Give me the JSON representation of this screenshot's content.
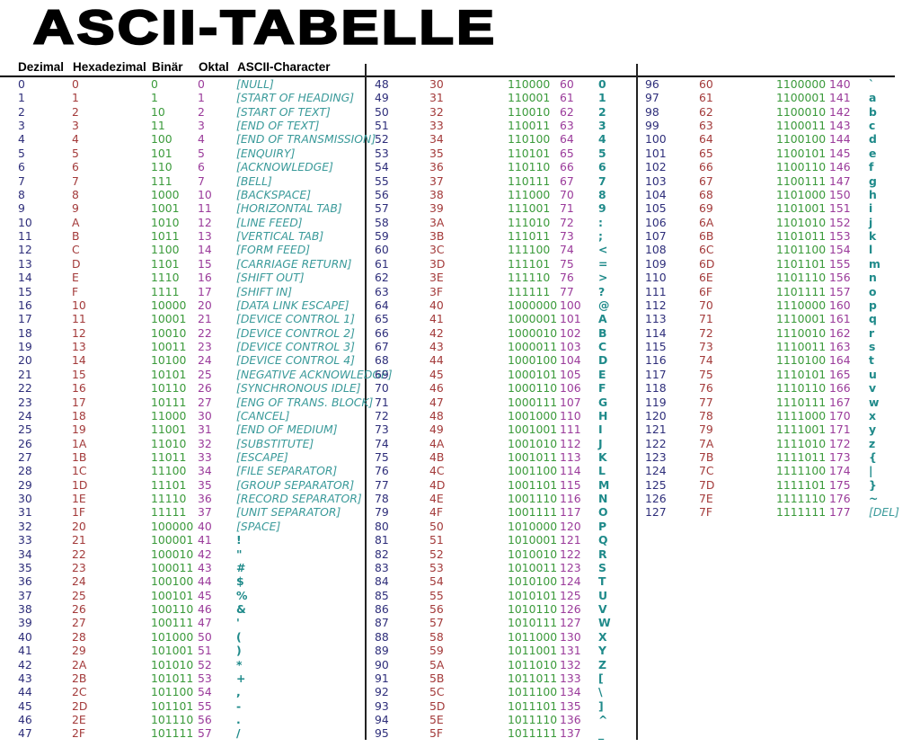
{
  "title": "ASCII-TABELLE",
  "headers": {
    "decimal": "Dezimal",
    "hex": "Hexadezimal",
    "binary": "Binär",
    "octal": "Oktal",
    "char": "ASCII-Character"
  },
  "colors": {
    "decimal": "#2e2e7a",
    "hex": "#a33a3a",
    "binary": "#3a9a3a",
    "octal": "#9a3a9a",
    "char": "#1f8a8a"
  },
  "control_names": [
    "[NULL]",
    "[START OF HEADING]",
    "[START OF TEXT]",
    "[END OF TEXT]",
    "[END OF TRANSMISSION]",
    "[ENQUIRY]",
    "[ACKNOWLEDGE]",
    "[BELL]",
    "[BACKSPACE]",
    "[HORIZONTAL TAB]",
    "[LINE FEED]",
    "[VERTICAL TAB]",
    "[FORM FEED]",
    "[CARRIAGE RETURN]",
    "[SHIFT OUT]",
    "[SHIFT IN]",
    "[DATA LINK ESCAPE]",
    "[DEVICE CONTROL 1]",
    "[DEVICE CONTROL 2]",
    "[DEVICE CONTROL 3]",
    "[DEVICE CONTROL 4]",
    "[NEGATIVE ACKNOWLEDGE]",
    "[SYNCHRONOUS IDLE]",
    "[ENG OF TRANS. BLOCK]",
    "[CANCEL]",
    "[END OF MEDIUM]",
    "[SUBSTITUTE]",
    "[ESCAPE]",
    "[FILE SEPARATOR]",
    "[GROUP SEPARATOR]",
    "[RECORD SEPARATOR]",
    "[UNIT SEPARATOR]",
    "[SPACE]"
  ],
  "rows": [
    [
      "0",
      "0",
      "0",
      "0",
      "[NULL]"
    ],
    [
      "1",
      "1",
      "1",
      "1",
      "[START OF HEADING]"
    ],
    [
      "2",
      "2",
      "10",
      "2",
      "[START OF TEXT]"
    ],
    [
      "3",
      "3",
      "11",
      "3",
      "[END OF TEXT]"
    ],
    [
      "4",
      "4",
      "100",
      "4",
      "[END OF TRANSMISSION]"
    ],
    [
      "5",
      "5",
      "101",
      "5",
      "[ENQUIRY]"
    ],
    [
      "6",
      "6",
      "110",
      "6",
      "[ACKNOWLEDGE]"
    ],
    [
      "7",
      "7",
      "111",
      "7",
      "[BELL]"
    ],
    [
      "8",
      "8",
      "1000",
      "10",
      "[BACKSPACE]"
    ],
    [
      "9",
      "9",
      "1001",
      "11",
      "[HORIZONTAL TAB]"
    ],
    [
      "10",
      "A",
      "1010",
      "12",
      "[LINE FEED]"
    ],
    [
      "11",
      "B",
      "1011",
      "13",
      "[VERTICAL TAB]"
    ],
    [
      "12",
      "C",
      "1100",
      "14",
      "[FORM FEED]"
    ],
    [
      "13",
      "D",
      "1101",
      "15",
      "[CARRIAGE RETURN]"
    ],
    [
      "14",
      "E",
      "1110",
      "16",
      "[SHIFT OUT]"
    ],
    [
      "15",
      "F",
      "1111",
      "17",
      "[SHIFT IN]"
    ],
    [
      "16",
      "10",
      "10000",
      "20",
      "[DATA LINK ESCAPE]"
    ],
    [
      "17",
      "11",
      "10001",
      "21",
      "[DEVICE CONTROL 1]"
    ],
    [
      "18",
      "12",
      "10010",
      "22",
      "[DEVICE CONTROL 2]"
    ],
    [
      "19",
      "13",
      "10011",
      "23",
      "[DEVICE CONTROL 3]"
    ],
    [
      "20",
      "14",
      "10100",
      "24",
      "[DEVICE CONTROL 4]"
    ],
    [
      "21",
      "15",
      "10101",
      "25",
      "[NEGATIVE ACKNOWLEDGE]"
    ],
    [
      "22",
      "16",
      "10110",
      "26",
      "[SYNCHRONOUS IDLE]"
    ],
    [
      "23",
      "17",
      "10111",
      "27",
      "[ENG OF TRANS. BLOCK]"
    ],
    [
      "24",
      "18",
      "11000",
      "30",
      "[CANCEL]"
    ],
    [
      "25",
      "19",
      "11001",
      "31",
      "[END OF MEDIUM]"
    ],
    [
      "26",
      "1A",
      "11010",
      "32",
      "[SUBSTITUTE]"
    ],
    [
      "27",
      "1B",
      "11011",
      "33",
      "[ESCAPE]"
    ],
    [
      "28",
      "1C",
      "11100",
      "34",
      "[FILE SEPARATOR]"
    ],
    [
      "29",
      "1D",
      "11101",
      "35",
      "[GROUP SEPARATOR]"
    ],
    [
      "30",
      "1E",
      "11110",
      "36",
      "[RECORD SEPARATOR]"
    ],
    [
      "31",
      "1F",
      "11111",
      "37",
      "[UNIT SEPARATOR]"
    ],
    [
      "32",
      "20",
      "100000",
      "40",
      "[SPACE]"
    ],
    [
      "33",
      "21",
      "100001",
      "41",
      "!"
    ],
    [
      "34",
      "22",
      "100010",
      "42",
      "\""
    ],
    [
      "35",
      "23",
      "100011",
      "43",
      "#"
    ],
    [
      "36",
      "24",
      "100100",
      "44",
      "$"
    ],
    [
      "37",
      "25",
      "100101",
      "45",
      "%"
    ],
    [
      "38",
      "26",
      "100110",
      "46",
      "&"
    ],
    [
      "39",
      "27",
      "100111",
      "47",
      "'"
    ],
    [
      "40",
      "28",
      "101000",
      "50",
      "("
    ],
    [
      "41",
      "29",
      "101001",
      "51",
      ")"
    ],
    [
      "42",
      "2A",
      "101010",
      "52",
      "*"
    ],
    [
      "43",
      "2B",
      "101011",
      "53",
      "+"
    ],
    [
      "44",
      "2C",
      "101100",
      "54",
      ","
    ],
    [
      "45",
      "2D",
      "101101",
      "55",
      "-"
    ],
    [
      "46",
      "2E",
      "101110",
      "56",
      "."
    ],
    [
      "47",
      "2F",
      "101111",
      "57",
      "/"
    ],
    [
      "48",
      "30",
      "110000",
      "60",
      "0"
    ],
    [
      "49",
      "31",
      "110001",
      "61",
      "1"
    ],
    [
      "50",
      "32",
      "110010",
      "62",
      "2"
    ],
    [
      "51",
      "33",
      "110011",
      "63",
      "3"
    ],
    [
      "52",
      "34",
      "110100",
      "64",
      "4"
    ],
    [
      "53",
      "35",
      "110101",
      "65",
      "5"
    ],
    [
      "54",
      "36",
      "110110",
      "66",
      "6"
    ],
    [
      "55",
      "37",
      "110111",
      "67",
      "7"
    ],
    [
      "56",
      "38",
      "111000",
      "70",
      "8"
    ],
    [
      "57",
      "39",
      "111001",
      "71",
      "9"
    ],
    [
      "58",
      "3A",
      "111010",
      "72",
      ":"
    ],
    [
      "59",
      "3B",
      "111011",
      "73",
      ";"
    ],
    [
      "60",
      "3C",
      "111100",
      "74",
      "<"
    ],
    [
      "61",
      "3D",
      "111101",
      "75",
      "="
    ],
    [
      "62",
      "3E",
      "111110",
      "76",
      ">"
    ],
    [
      "63",
      "3F",
      "111111",
      "77",
      "?"
    ],
    [
      "64",
      "40",
      "1000000",
      "100",
      "@"
    ],
    [
      "65",
      "41",
      "1000001",
      "101",
      "A"
    ],
    [
      "66",
      "42",
      "1000010",
      "102",
      "B"
    ],
    [
      "67",
      "43",
      "1000011",
      "103",
      "C"
    ],
    [
      "68",
      "44",
      "1000100",
      "104",
      "D"
    ],
    [
      "69",
      "45",
      "1000101",
      "105",
      "E"
    ],
    [
      "70",
      "46",
      "1000110",
      "106",
      "F"
    ],
    [
      "71",
      "47",
      "1000111",
      "107",
      "G"
    ],
    [
      "72",
      "48",
      "1001000",
      "110",
      "H"
    ],
    [
      "73",
      "49",
      "1001001",
      "111",
      "I"
    ],
    [
      "74",
      "4A",
      "1001010",
      "112",
      "J"
    ],
    [
      "75",
      "4B",
      "1001011",
      "113",
      "K"
    ],
    [
      "76",
      "4C",
      "1001100",
      "114",
      "L"
    ],
    [
      "77",
      "4D",
      "1001101",
      "115",
      "M"
    ],
    [
      "78",
      "4E",
      "1001110",
      "116",
      "N"
    ],
    [
      "79",
      "4F",
      "1001111",
      "117",
      "O"
    ],
    [
      "80",
      "50",
      "1010000",
      "120",
      "P"
    ],
    [
      "81",
      "51",
      "1010001",
      "121",
      "Q"
    ],
    [
      "82",
      "52",
      "1010010",
      "122",
      "R"
    ],
    [
      "83",
      "53",
      "1010011",
      "123",
      "S"
    ],
    [
      "84",
      "54",
      "1010100",
      "124",
      "T"
    ],
    [
      "85",
      "55",
      "1010101",
      "125",
      "U"
    ],
    [
      "86",
      "56",
      "1010110",
      "126",
      "V"
    ],
    [
      "87",
      "57",
      "1010111",
      "127",
      "W"
    ],
    [
      "88",
      "58",
      "1011000",
      "130",
      "X"
    ],
    [
      "89",
      "59",
      "1011001",
      "131",
      "Y"
    ],
    [
      "90",
      "5A",
      "1011010",
      "132",
      "Z"
    ],
    [
      "91",
      "5B",
      "1011011",
      "133",
      "["
    ],
    [
      "92",
      "5C",
      "1011100",
      "134",
      "\\"
    ],
    [
      "93",
      "5D",
      "1011101",
      "135",
      "]"
    ],
    [
      "94",
      "5E",
      "1011110",
      "136",
      "^"
    ],
    [
      "95",
      "5F",
      "1011111",
      "137",
      "_"
    ],
    [
      "96",
      "60",
      "1100000",
      "140",
      "`"
    ],
    [
      "97",
      "61",
      "1100001",
      "141",
      "a"
    ],
    [
      "98",
      "62",
      "1100010",
      "142",
      "b"
    ],
    [
      "99",
      "63",
      "1100011",
      "143",
      "c"
    ],
    [
      "100",
      "64",
      "1100100",
      "144",
      "d"
    ],
    [
      "101",
      "65",
      "1100101",
      "145",
      "e"
    ],
    [
      "102",
      "66",
      "1100110",
      "146",
      "f"
    ],
    [
      "103",
      "67",
      "1100111",
      "147",
      "g"
    ],
    [
      "104",
      "68",
      "1101000",
      "150",
      "h"
    ],
    [
      "105",
      "69",
      "1101001",
      "151",
      "i"
    ],
    [
      "106",
      "6A",
      "1101010",
      "152",
      "j"
    ],
    [
      "107",
      "6B",
      "1101011",
      "153",
      "k"
    ],
    [
      "108",
      "6C",
      "1101100",
      "154",
      "l"
    ],
    [
      "109",
      "6D",
      "1101101",
      "155",
      "m"
    ],
    [
      "110",
      "6E",
      "1101110",
      "156",
      "n"
    ],
    [
      "111",
      "6F",
      "1101111",
      "157",
      "o"
    ],
    [
      "112",
      "70",
      "1110000",
      "160",
      "p"
    ],
    [
      "113",
      "71",
      "1110001",
      "161",
      "q"
    ],
    [
      "114",
      "72",
      "1110010",
      "162",
      "r"
    ],
    [
      "115",
      "73",
      "1110011",
      "163",
      "s"
    ],
    [
      "116",
      "74",
      "1110100",
      "164",
      "t"
    ],
    [
      "117",
      "75",
      "1110101",
      "165",
      "u"
    ],
    [
      "118",
      "76",
      "1110110",
      "166",
      "v"
    ],
    [
      "119",
      "77",
      "1110111",
      "167",
      "w"
    ],
    [
      "120",
      "78",
      "1111000",
      "170",
      "x"
    ],
    [
      "121",
      "79",
      "1111001",
      "171",
      "y"
    ],
    [
      "122",
      "7A",
      "1111010",
      "172",
      "z"
    ],
    [
      "123",
      "7B",
      "1111011",
      "173",
      "{"
    ],
    [
      "124",
      "7C",
      "1111100",
      "174",
      "|"
    ],
    [
      "125",
      "7D",
      "1111101",
      "175",
      "}"
    ],
    [
      "126",
      "7E",
      "1111110",
      "176",
      "~"
    ],
    [
      "127",
      "7F",
      "1111111",
      "177",
      "[DEL]"
    ]
  ]
}
